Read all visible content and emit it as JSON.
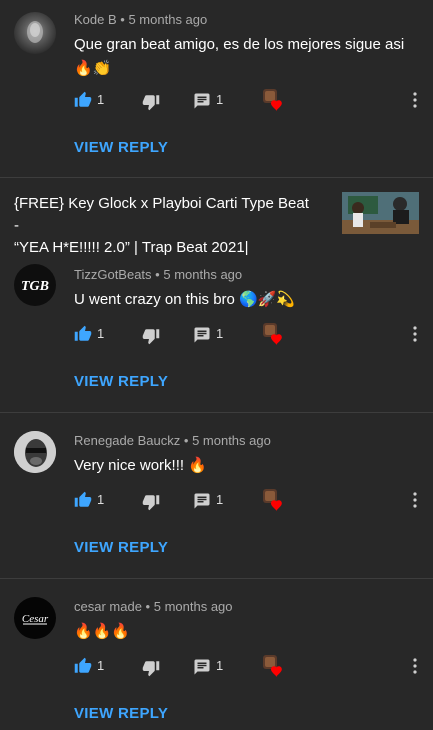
{
  "comments": [
    {
      "author": "Kode B",
      "time": "5 months ago",
      "text_line1": "Que gran beat amigo, es de los mejores sigue asi",
      "text_line2": "🔥👏",
      "likes": "1",
      "replies": "1",
      "view_reply": "VIEW REPLY"
    },
    {
      "author": "TizzGotBeats",
      "time": "5 months ago",
      "text": "U went crazy on this bro 🌎🚀💫",
      "avatar_text": "TGB",
      "likes": "1",
      "replies": "1",
      "view_reply": "VIEW REPLY"
    },
    {
      "author": "Renegade Bauckz",
      "time": "5 months ago",
      "text": "Very nice work!!! 🔥",
      "likes": "1",
      "replies": "1",
      "view_reply": "VIEW REPLY"
    },
    {
      "author": "cesar made",
      "time": "5 months ago",
      "text": "🔥🔥🔥",
      "avatar_text": "Cesar",
      "likes": "1",
      "replies": "1",
      "view_reply": "VIEW REPLY"
    }
  ],
  "video": {
    "title_line1": "{FREE} Key Glock x Playboi Carti Type Beat  -",
    "title_line2": "“YEA H*E!!!!! 2.0” | Trap Beat 2021|"
  },
  "separator": "•",
  "colors": {
    "background": "#282828",
    "link": "#3ea6ff",
    "like_active": "#3ea6ff",
    "meta": "#aaaaaa",
    "divider": "#3d3d3d"
  }
}
